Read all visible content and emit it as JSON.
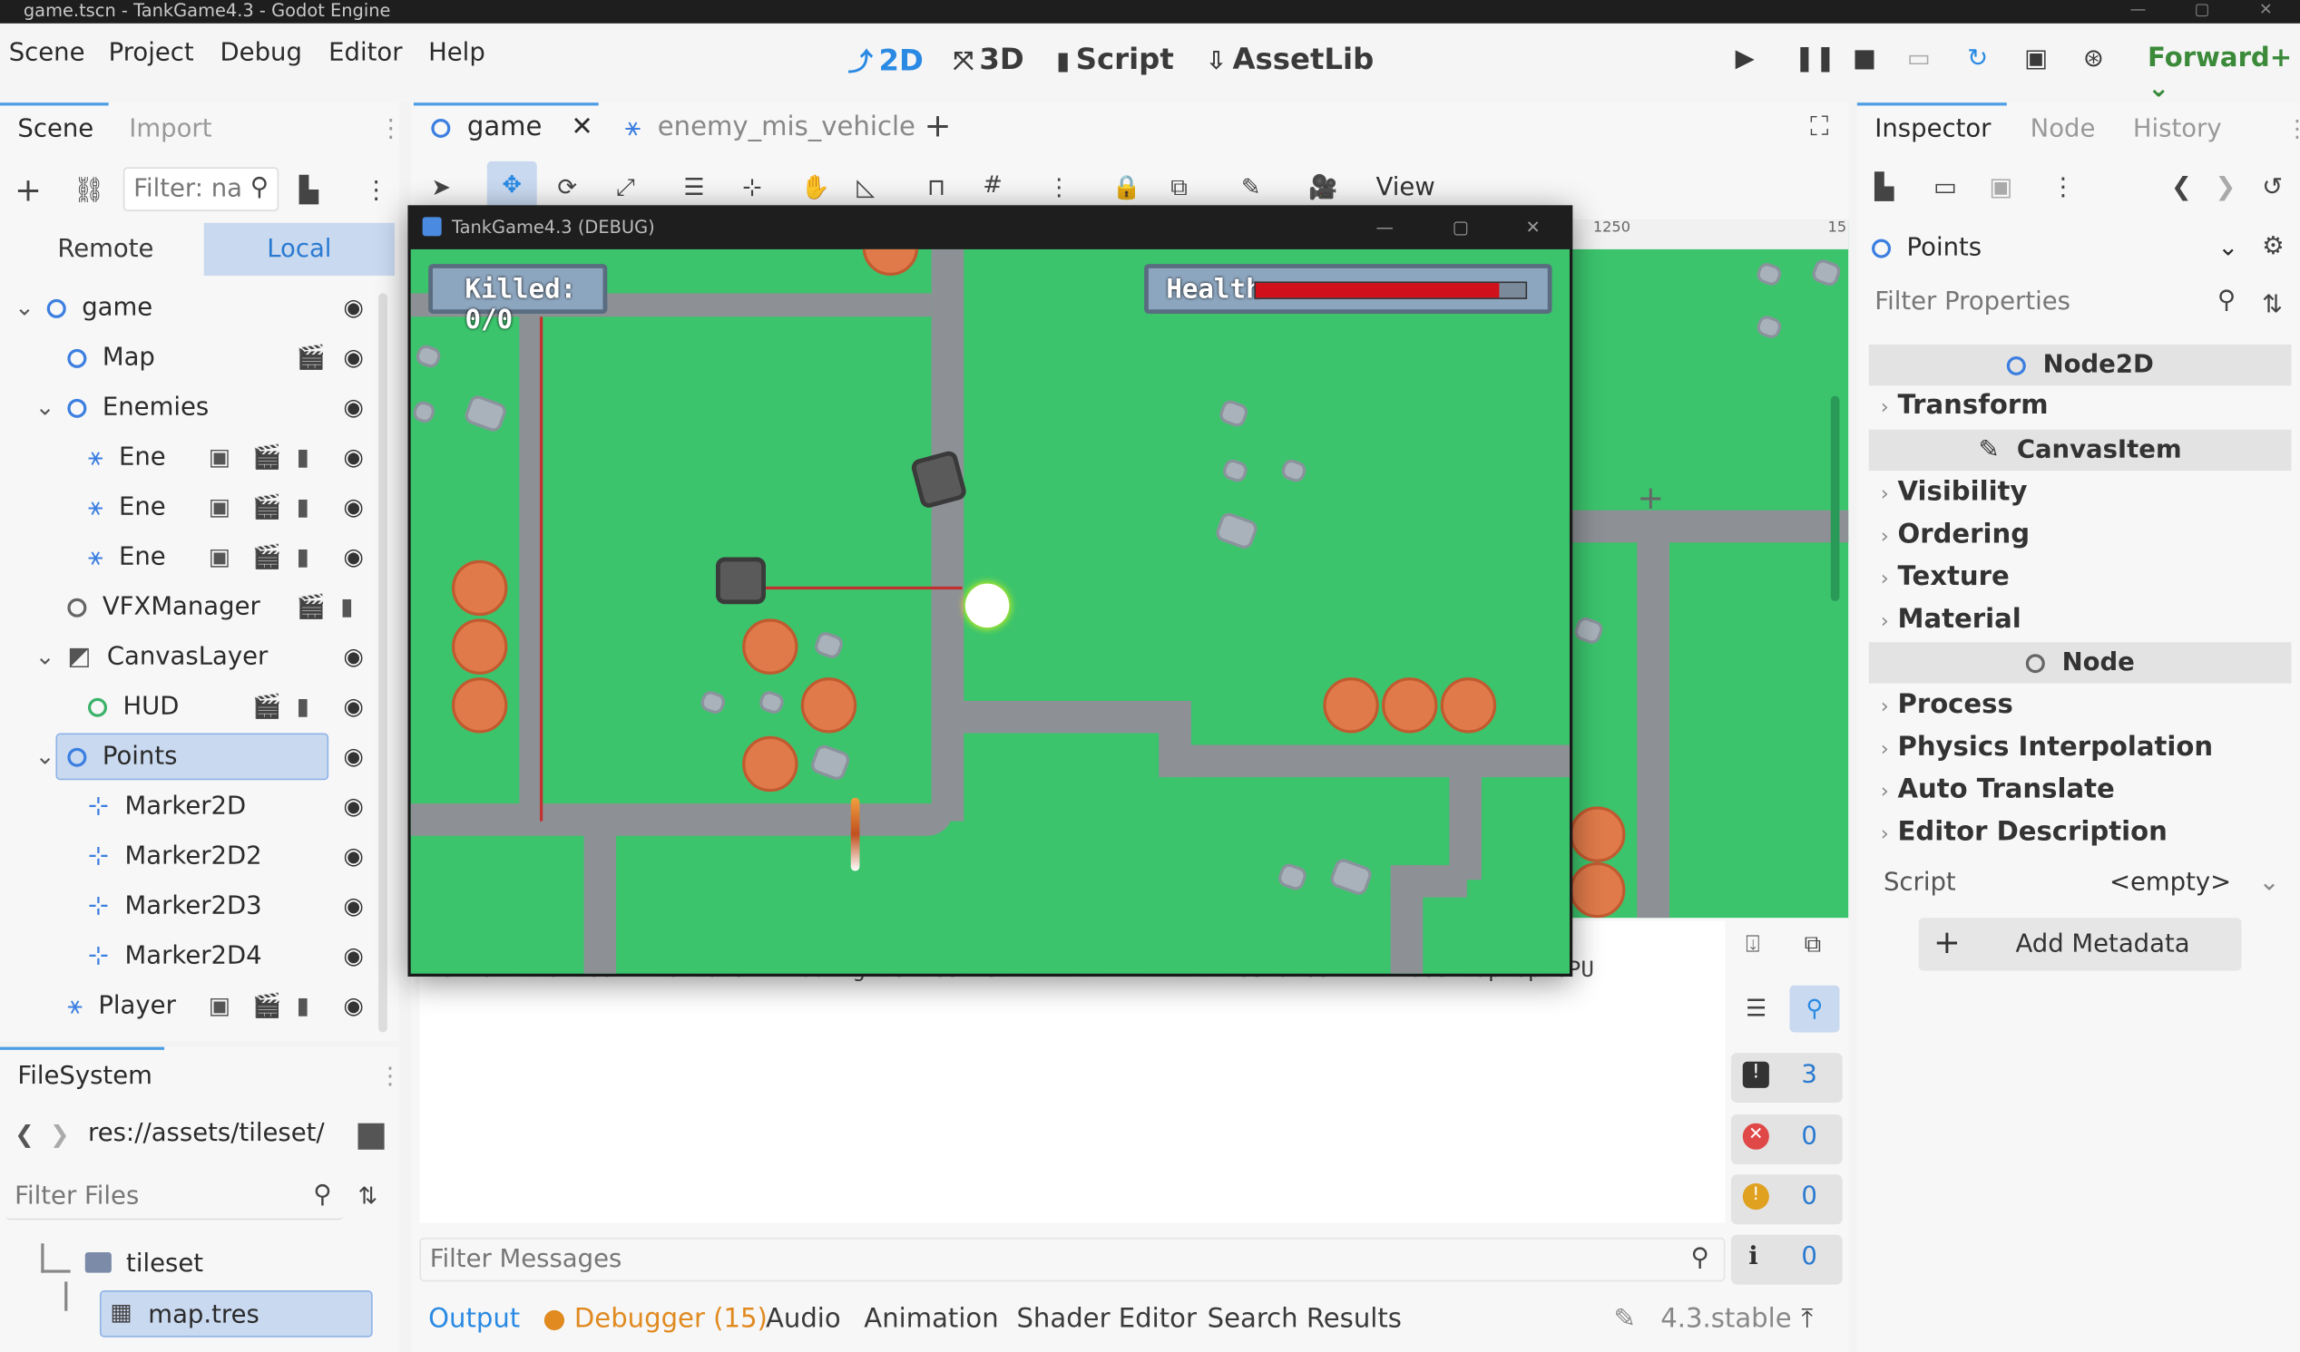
{
  "window": {
    "title": "game.tscn - TankGame4.3 - Godot Engine"
  },
  "menu": [
    "Scene",
    "Project",
    "Debug",
    "Editor",
    "Help"
  ],
  "workspaces": [
    {
      "icon": "2d-icon",
      "label": "2D",
      "active": true
    },
    {
      "icon": "3d-icon",
      "label": "3D",
      "active": false
    },
    {
      "icon": "script-icon",
      "label": "Script",
      "active": false
    },
    {
      "icon": "assetlib-icon",
      "label": "AssetLib",
      "active": false
    }
  ],
  "renderer": "Forward+",
  "scene_dock": {
    "tabs": [
      "Scene",
      "Import"
    ],
    "filter_placeholder": "Filter: na",
    "remote_label": "Remote",
    "local_label": "Local",
    "tree": [
      {
        "name": "game"
      },
      {
        "name": "Map"
      },
      {
        "name": "Enemies"
      },
      {
        "name": "Ene"
      },
      {
        "name": "Ene"
      },
      {
        "name": "Ene"
      },
      {
        "name": "VFXManager"
      },
      {
        "name": "CanvasLayer"
      },
      {
        "name": "HUD"
      },
      {
        "name": "Points"
      },
      {
        "name": "Marker2D"
      },
      {
        "name": "Marker2D2"
      },
      {
        "name": "Marker2D3"
      },
      {
        "name": "Marker2D4"
      },
      {
        "name": "Player"
      }
    ]
  },
  "filesystem": {
    "title": "FileSystem",
    "path": "res://assets/tileset/",
    "filter_placeholder": "Filter Files",
    "items": [
      "tileset",
      "map.tres"
    ]
  },
  "editor_tabs": [
    "game",
    "enemy_mis_vehicle"
  ],
  "toolbar": {
    "view_label": "View"
  },
  "ruler": {
    "mark1": "1250",
    "mark2": "15"
  },
  "game_window": {
    "title": "TankGame4.3 (DEBUG)",
    "killed": "Killed: 0/0",
    "health_label": "Health",
    "health_fraction": 0.9
  },
  "output": {
    "log_line": "Vulkan 1.3.280 - Forward+ - Using Device #0: NVIDIA - NVIDIA GeForce RTX 4060 Laptop GPU",
    "filter_placeholder": "Filter Messages",
    "counts": {
      "messages": "3",
      "errors": "0",
      "warnings": "0",
      "info": "0"
    }
  },
  "bottom_tabs": [
    "Output",
    "Debugger (15)",
    "Audio",
    "Animation",
    "Shader Editor",
    "Search Results"
  ],
  "version": "4.3.stable",
  "inspector": {
    "tabs": [
      "Inspector",
      "Node",
      "History"
    ],
    "object": "Points",
    "filter_placeholder": "Filter Properties",
    "sections": {
      "node2d": "Node2D",
      "canvasitem": "CanvasItem",
      "node": "Node"
    },
    "props_node2d": [
      "Transform"
    ],
    "props_canvas": [
      "Visibility",
      "Ordering",
      "Texture",
      "Material"
    ],
    "props_node": [
      "Process",
      "Physics Interpolation",
      "Auto Translate",
      "Editor Description"
    ],
    "script_label": "Script",
    "script_value": "<empty>",
    "add_metadata": "Add Metadata"
  },
  "colors": {
    "accent": "#2a8ae3",
    "grass": "#3bc46c",
    "road": "#8d9095",
    "bush": "#e07a4a",
    "health": "#d0101a"
  }
}
